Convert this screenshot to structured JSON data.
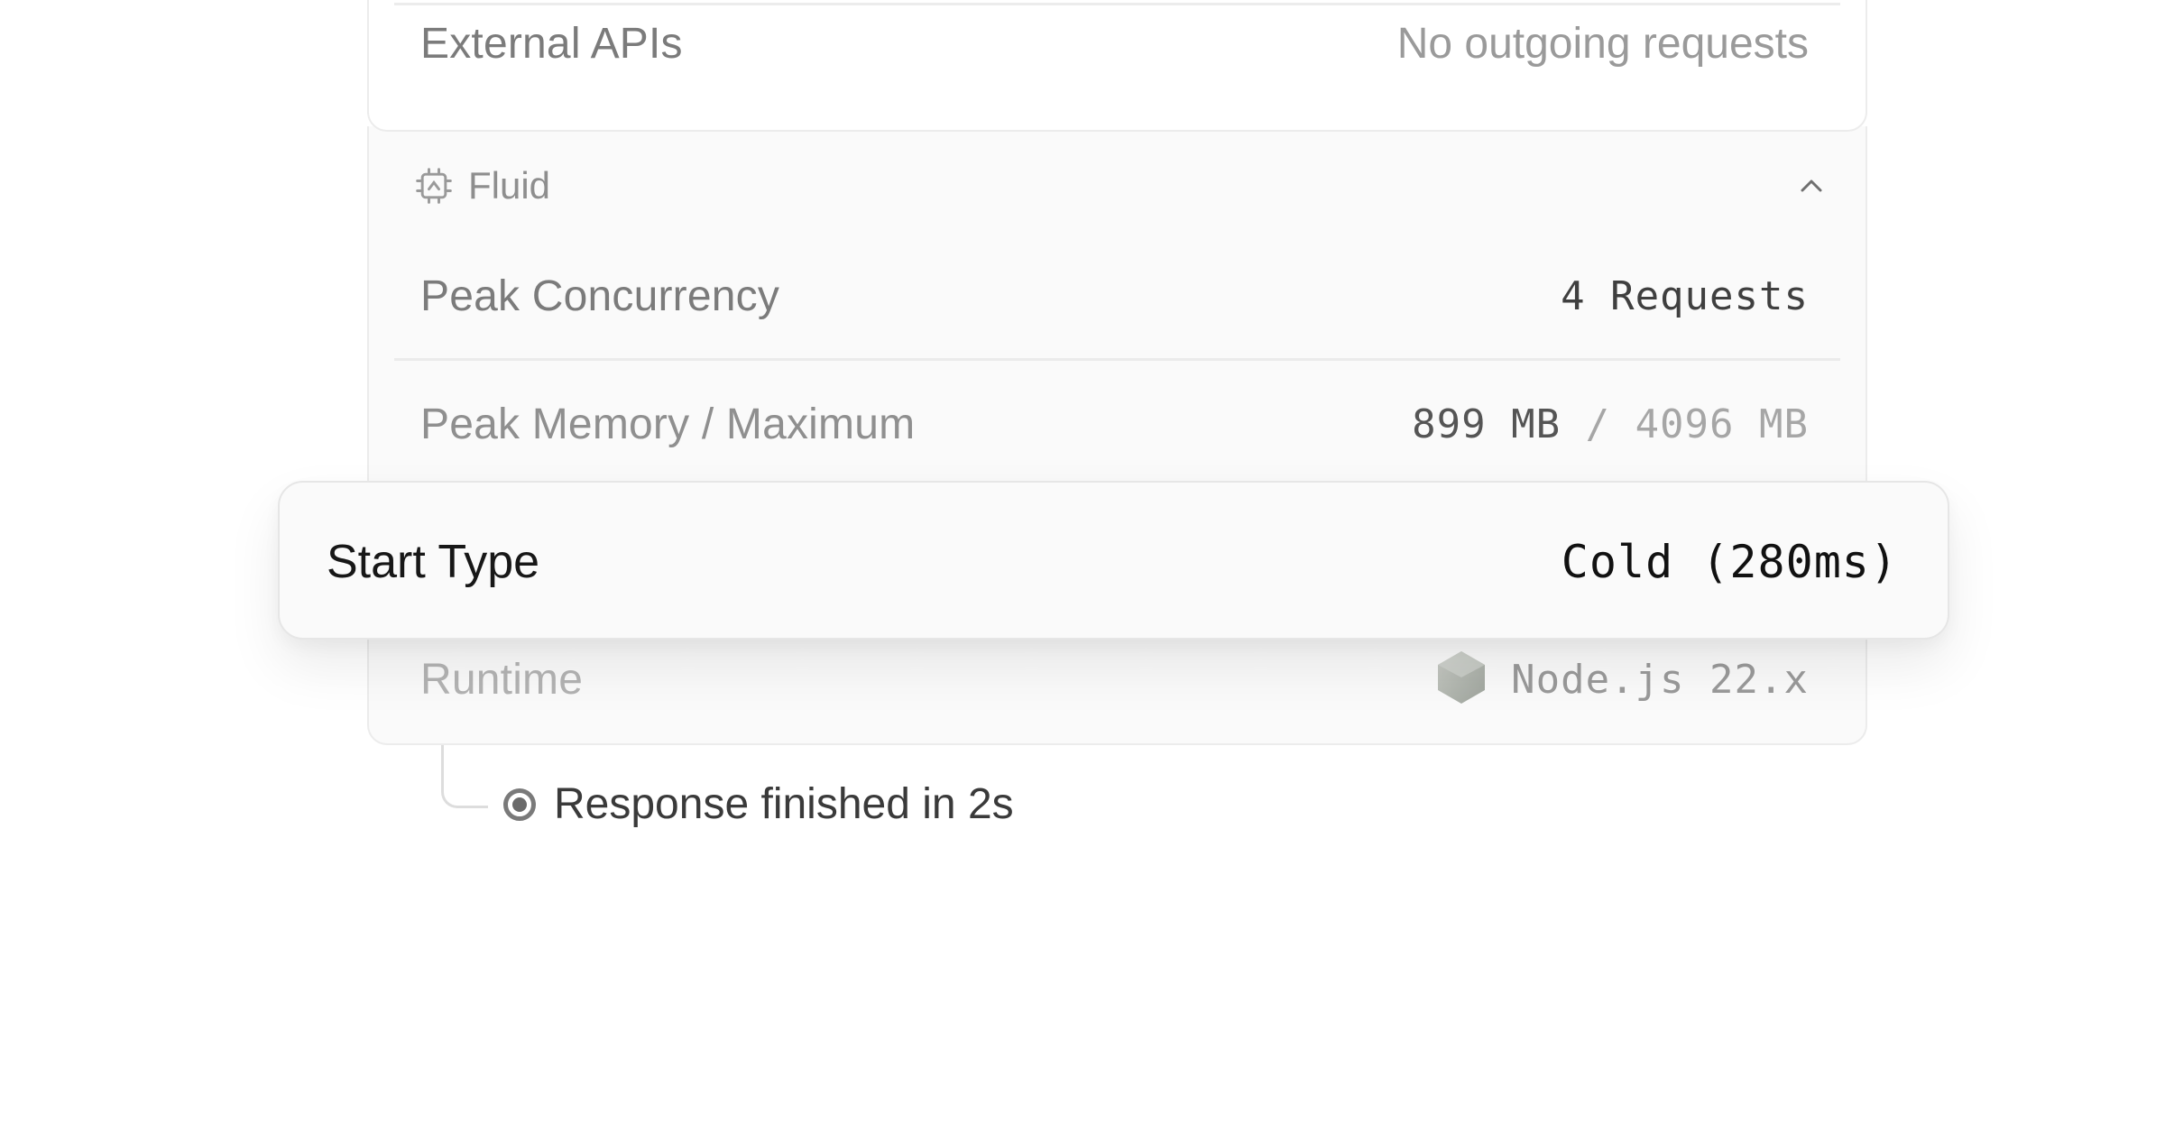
{
  "external_apis": {
    "label": "External APIs",
    "value": "No outgoing requests"
  },
  "fluid": {
    "title": "Fluid",
    "icon": "cpu-chip-icon",
    "collapse_icon": "chevron-up-icon",
    "peak_concurrency": {
      "label": "Peak Concurrency",
      "value": "4 Requests"
    },
    "peak_memory": {
      "label": "Peak Memory / Maximum",
      "used": "899 MB",
      "separator": " / ",
      "maximum": "4096 MB"
    },
    "start_type": {
      "label": "Start Type",
      "value": "Cold (280ms)"
    },
    "runtime": {
      "label": "Runtime",
      "icon": "nodejs-hexagon-icon",
      "value": "Node.js 22.x"
    }
  },
  "timeline": {
    "status_icon": "radio-dot-icon",
    "response_text": "Response finished in 2s"
  },
  "colors": {
    "card_border": "#ececec",
    "fluid_background": "#fafafa",
    "text_primary": "#171717",
    "text_muted": "#7b7b7b"
  }
}
